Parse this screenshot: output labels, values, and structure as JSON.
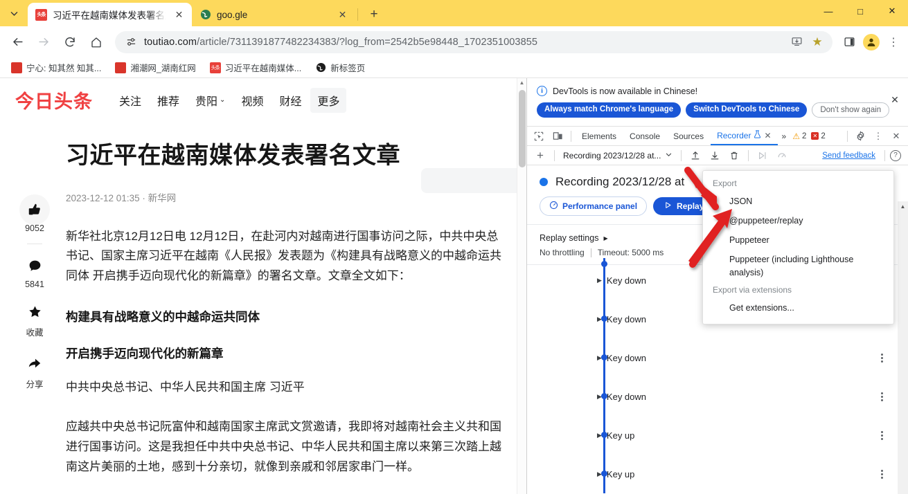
{
  "browser": {
    "tabs": [
      {
        "title": "习近平在越南媒体发表署名文章",
        "favicon": "头条",
        "active": true
      },
      {
        "title": "goo.gle",
        "favicon": "globe-icon",
        "active": false
      }
    ],
    "tab_search_icon": "chevron-down-icon",
    "new_tab_label": "+",
    "window_controls": {
      "minimize": "—",
      "maximize": "□",
      "close": "✕"
    },
    "nav": {
      "back": "←",
      "forward": "→",
      "reload": "⟳",
      "home": "⌂"
    },
    "omnibox": {
      "permission_icon": "site-settings-icon",
      "url_host": "toutiao.com",
      "url_path": "/article/7311391877482234383/?log_from=2542b5e98448_1702351003855",
      "install_icon": "install-app-icon",
      "bookmark_icon": "star-icon"
    },
    "toolbar_right": {
      "side_panel": "side-panel-icon",
      "profile": "avatar-icon",
      "menu": "⋮"
    },
    "bookmarks": [
      {
        "label": "宁心: 知其然 知其...",
        "icon": "red-flame-icon"
      },
      {
        "label": "湘潮网_湖南红网",
        "icon": "red-flame-icon"
      },
      {
        "label": "习近平在越南媒体...",
        "icon": "toutiao-icon"
      },
      {
        "label": "新标签页",
        "icon": "globe-icon"
      }
    ]
  },
  "page": {
    "logo": "今日头条",
    "nav": [
      {
        "label": "关注",
        "caret": false
      },
      {
        "label": "推荐",
        "caret": false
      },
      {
        "label": "贵阳",
        "caret": true
      },
      {
        "label": "视频",
        "caret": false
      },
      {
        "label": "财经",
        "caret": false
      },
      {
        "label": "更多",
        "caret": false,
        "highlighted": true
      }
    ],
    "article": {
      "title": "习近平在越南媒体发表署名文章",
      "meta": "2023-12-12 01:35 · 新华网",
      "paragraphs": [
        "新华社北京12月12日电 12月12日，在赴河内对越南进行国事访问之际，中共中央总",
        "书记、国家主席习近平在越南《人民报》发表题为《构建具有战略意义的中越命运共",
        "同体 开启携手迈向现代化的新篇章》的署名文章。文章全文如下："
      ],
      "heading1": "构建具有战略意义的中越命运共同体",
      "heading2": "开启携手迈向现代化的新篇章",
      "byline": "中共中央总书记、中华人民共和国主席 习近平",
      "paragraphs2": [
        "应越共中央总书记阮富仲和越南国家主席武文赏邀请，我即将对越南社会主义共和国",
        "进行国事访问。这是我担任中共中央总书记、中华人民共和国主席以来第三次踏上越",
        "南这片美丽的土地，感到十分亲切，就像到亲戚和邻居家串门一样。"
      ]
    },
    "actions": [
      {
        "icon": "thumbs-up-icon",
        "label": "9052"
      },
      {
        "icon": "comment-icon",
        "label": "5841"
      },
      {
        "icon": "star-icon",
        "label": "收藏"
      },
      {
        "icon": "share-icon",
        "label": "分享"
      }
    ]
  },
  "devtools": {
    "banner": {
      "icon": "info-icon",
      "text": "DevTools is now available in Chinese!",
      "btn_primary_1": "Always match Chrome's language",
      "btn_primary_2": "Switch DevTools to Chinese",
      "btn_ghost": "Don't show again",
      "close": "✕"
    },
    "tabs": {
      "inspect_icon": "inspect-element-icon",
      "device_icon": "device-toolbar-icon",
      "items": [
        "Elements",
        "Console",
        "Sources"
      ],
      "active": "Recorder",
      "active_flask": "⚗",
      "active_close": "✕",
      "overflow": "»",
      "warnings": "2",
      "errors": "2",
      "settings_icon": "gear-icon",
      "more_icon": "⋮",
      "close_icon": "✕"
    },
    "subbar": {
      "add_icon": "+",
      "recording_name": "Recording 2023/12/28 at...",
      "dropdown_caret": "⌄",
      "import_icon": "import-icon",
      "export_icon": "export-icon",
      "delete_icon": "delete-icon",
      "replay_icon": "replay-step-icon",
      "measure_icon": "performance-icon",
      "send_feedback": "Send feedback",
      "help_icon": "?"
    },
    "recording": {
      "title": "Recording 2023/12/28 at",
      "perf_button": "Performance panel",
      "perf_icon": "speedometer-icon",
      "replay_button": "Replay",
      "replay_play_icon": "▷",
      "settings_label": "Replay settings",
      "settings_caret": "▶",
      "throttling": "No throttling",
      "timeout": "Timeout: 5000 ms"
    },
    "steps": [
      {
        "label": "Key down"
      },
      {
        "label": "Key down"
      },
      {
        "label": "Key down"
      },
      {
        "label": "Key down"
      },
      {
        "label": "Key up"
      },
      {
        "label": "Key up"
      }
    ],
    "export_menu": {
      "section1": "Export",
      "items1": [
        "JSON",
        "@puppeteer/replay",
        "Puppeteer",
        "Puppeteer (including Lighthouse analysis)"
      ],
      "section2": "Export via extensions",
      "items2": [
        "Get extensions..."
      ]
    }
  },
  "colors": {
    "tabstrip_yellow": "#fdd95c",
    "devtools_blue": "#1a73e8",
    "button_blue": "#1a56d6",
    "toutiao_red": "#f04142",
    "annotation_red": "#e02020"
  }
}
